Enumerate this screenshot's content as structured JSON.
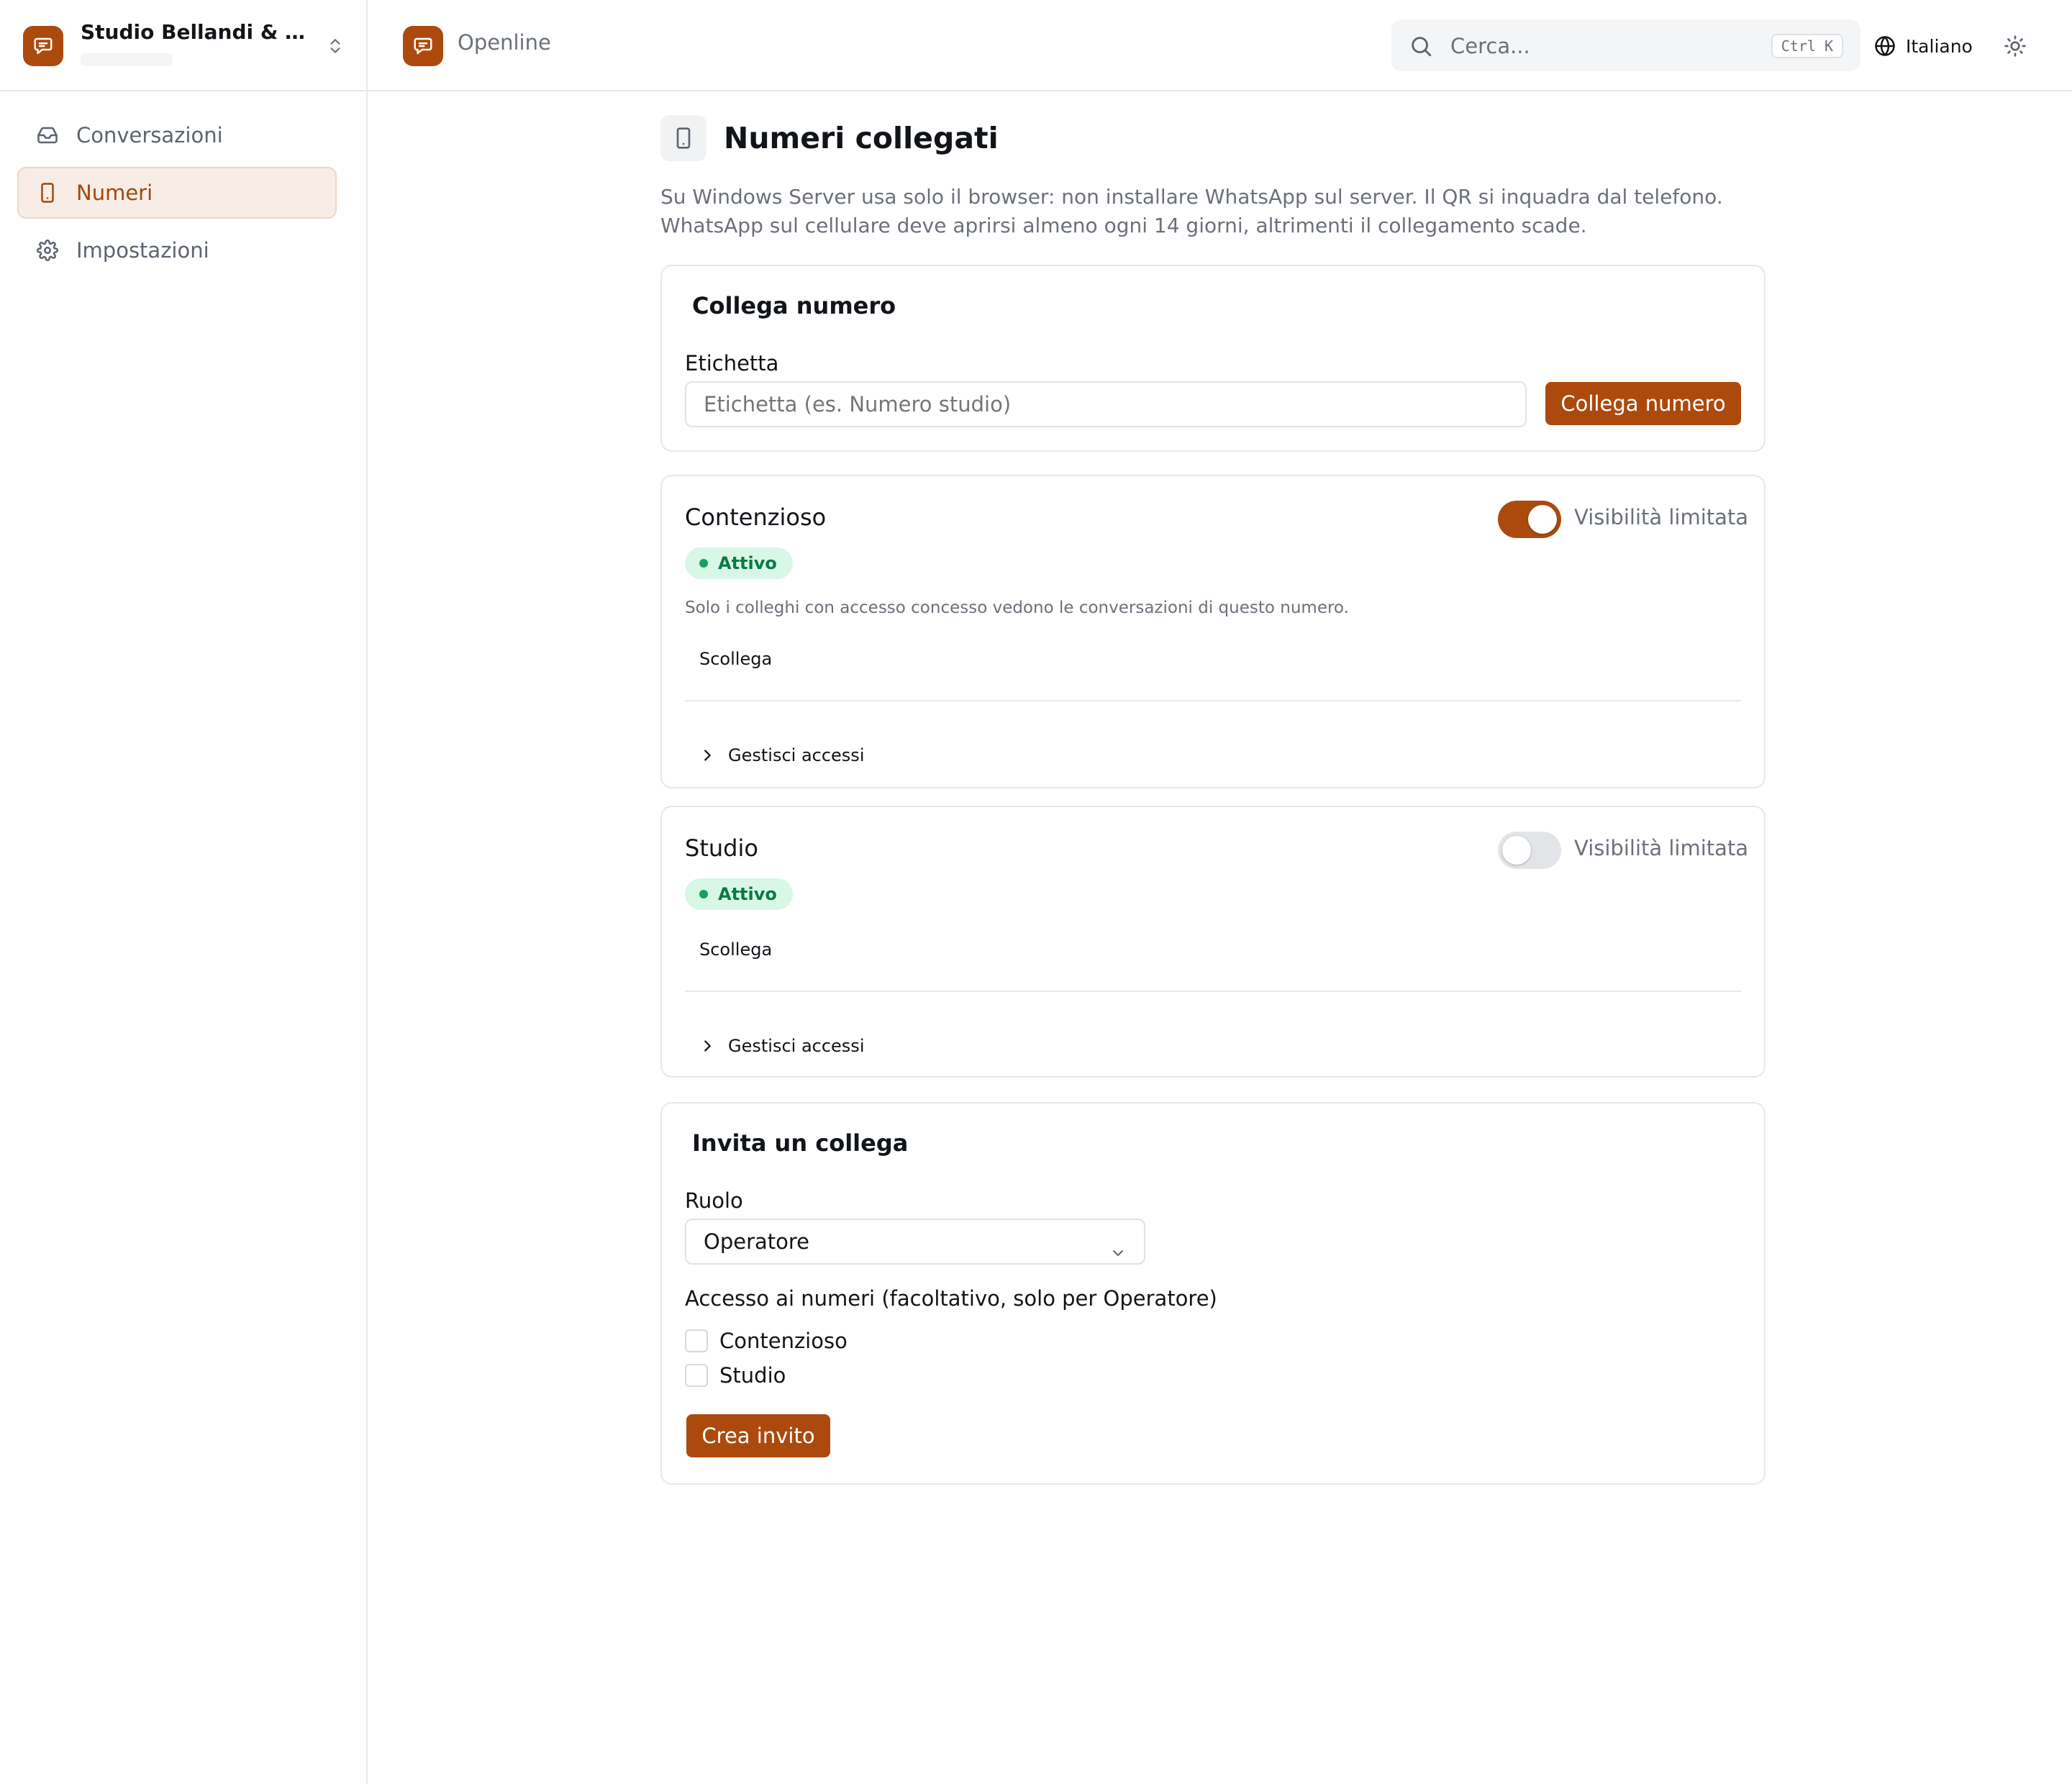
{
  "org": {
    "name": "Studio Bellandi & A…"
  },
  "sidebar": {
    "items": [
      {
        "label": "Conversazioni",
        "icon": "inbox-icon",
        "active": false
      },
      {
        "label": "Numeri",
        "icon": "smartphone-icon",
        "active": true
      },
      {
        "label": "Impostazioni",
        "icon": "gear-icon",
        "active": false
      }
    ]
  },
  "topbar": {
    "brand": "Openline",
    "search": {
      "placeholder": "Cerca...",
      "shortcut": "Ctrl K"
    },
    "language": "Italiano",
    "theme_icon": "sun-icon"
  },
  "colors": {
    "accent": "#ac4a0e",
    "success_bg": "#d8f7e6",
    "success_text": "#0a7a46"
  },
  "page": {
    "title": "Numeri collegati",
    "description": [
      "Su Windows Server usa solo il browser: non installare WhatsApp sul server. Il QR si inquadra dal telefono.",
      "WhatsApp sul cellulare deve aprirsi almeno ogni 14 giorni, altrimenti il collegamento scade."
    ]
  },
  "link_card": {
    "title": "Collega numero",
    "label": "Etichetta",
    "placeholder": "Etichetta (es. Numero studio)",
    "button": "Collega numero"
  },
  "numbers": [
    {
      "name": "Contenzioso",
      "status": "Attivo",
      "restricted": true,
      "toggle_label": "Visibilità limitata",
      "note": "Solo i colleghi con accesso concesso vedono le conversazioni di questo numero.",
      "disconnect": "Scollega",
      "manage": "Gestisci accessi"
    },
    {
      "name": "Studio",
      "status": "Attivo",
      "restricted": false,
      "toggle_label": "Visibilità limitata",
      "disconnect": "Scollega",
      "manage": "Gestisci accessi"
    }
  ],
  "invite": {
    "title": "Invita un collega",
    "role_label": "Ruolo",
    "role_value": "Operatore",
    "access_label": "Accesso ai numeri (facoltativo, solo per Operatore)",
    "options": [
      "Contenzioso",
      "Studio"
    ],
    "button": "Crea invito"
  }
}
